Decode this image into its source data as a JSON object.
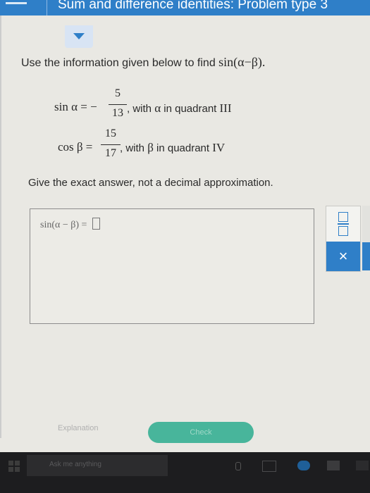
{
  "header": {
    "title": "Sum and difference identities: Problem type 3"
  },
  "problem": {
    "instruction_prefix": "Use the information given below to find ",
    "target_expression": "sin(α−β).",
    "line1_lhs": "sin α = −",
    "line1_num": "5",
    "line1_den": "13",
    "line1_rest_prefix": ", with ",
    "line1_var": "α",
    "line1_rest_mid": " in quadrant ",
    "line1_quadrant": "III",
    "line2_lhs": "cos β = ",
    "line2_num": "15",
    "line2_den": "17",
    "line2_rest_prefix": ", with ",
    "line2_var": "β",
    "line2_rest_mid": " in quadrant ",
    "line2_quadrant": "IV",
    "exact_note": "Give the exact answer, not a decimal approximation."
  },
  "answer": {
    "expression": "sin(α − β) = "
  },
  "tools": {
    "close_symbol": "×"
  },
  "buttons": {
    "explanation": "Explanation",
    "check": "Check"
  },
  "taskbar": {
    "search_placeholder": "Ask me anything"
  },
  "colors": {
    "brand_blue": "#2f7fc8",
    "check_green": "#48b59b"
  }
}
